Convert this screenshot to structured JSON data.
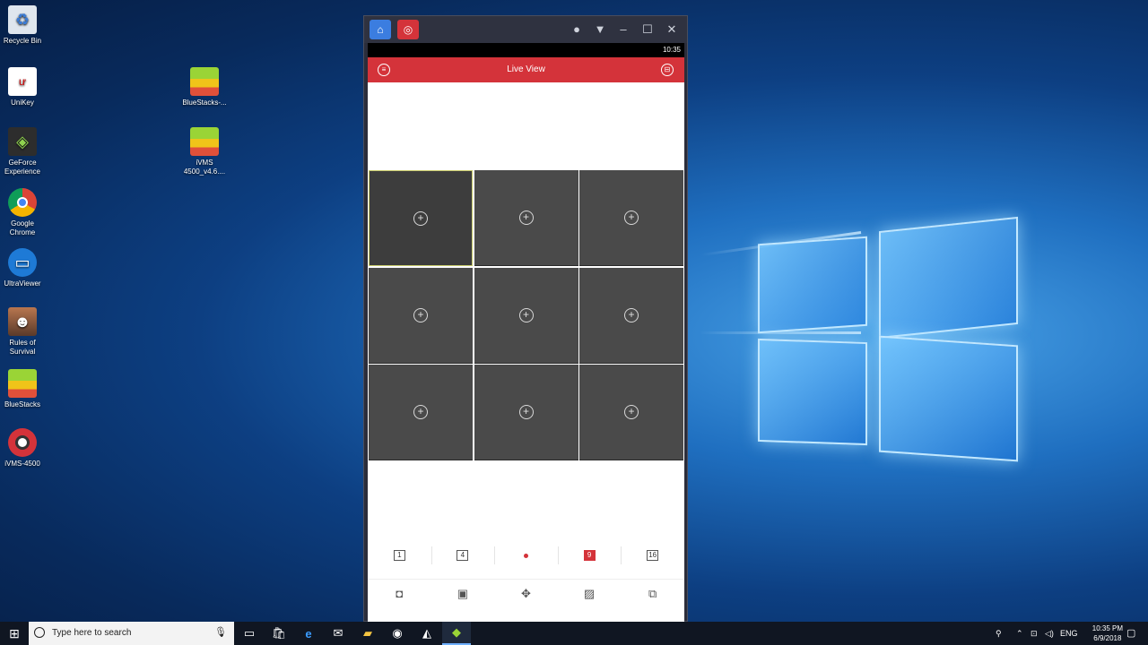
{
  "desktop": {
    "icons": [
      {
        "label": "Recycle Bin",
        "icon": "recycle-bin-icon"
      },
      {
        "label": "UniKey",
        "icon": "unikey-icon"
      },
      {
        "label": "GeForce Experience",
        "icon": "geforce-icon"
      },
      {
        "label": "Google Chrome",
        "icon": "chrome-icon"
      },
      {
        "label": "UltraViewer",
        "icon": "ultraviewer-icon"
      },
      {
        "label": "Rules of Survival",
        "icon": "rules-of-survival-icon"
      },
      {
        "label": "BlueStacks",
        "icon": "bluestacks-icon"
      },
      {
        "label": "iVMS-4500",
        "icon": "ivms-icon"
      },
      {
        "label": "BlueStacks-...",
        "icon": "bluestacks-installer-icon"
      },
      {
        "label": "iVMS 4500_v4.6....",
        "icon": "ivms-apk-icon"
      }
    ]
  },
  "emulator": {
    "status_time": "10:35",
    "app_title": "Live View",
    "grid_cells": 9,
    "split_options": [
      "1",
      "4",
      "9",
      "16"
    ],
    "active_split": "9",
    "accent_color": "#d4333a"
  },
  "taskbar": {
    "search_placeholder": "Type here to search",
    "language": "ENG",
    "time": "10:35 PM",
    "date": "6/9/2018"
  }
}
